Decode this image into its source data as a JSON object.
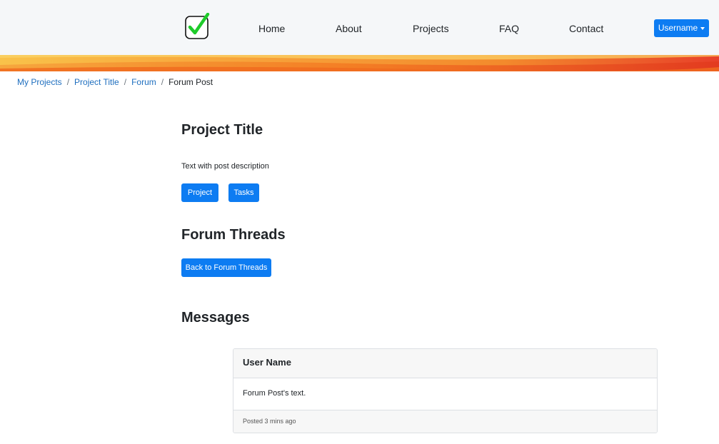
{
  "colors": {
    "primary": "#0d7cf2",
    "link": "#1f6fbf",
    "navbar_bg": "#f5f7f9",
    "wave_orange": "#f4811e",
    "wave_red": "#e8402a",
    "logo_check": "#1ecb2a"
  },
  "header": {
    "logo_icon": "checkbox-check-icon",
    "nav": [
      "Home",
      "About",
      "Projects",
      "FAQ",
      "Contact"
    ],
    "user_button": "Username"
  },
  "breadcrumb": {
    "items": [
      "My Projects",
      "Project Title",
      "Forum"
    ],
    "current": "Forum Post",
    "separator": "/"
  },
  "project": {
    "title": "Project Title",
    "description": "Text with post description",
    "buttons": [
      "Project",
      "Tasks"
    ]
  },
  "forum": {
    "heading": "Forum Threads",
    "back_button": "Back to Forum Threads"
  },
  "messages": {
    "heading": "Messages",
    "card": {
      "user_name": "User Name",
      "text": "Forum Post's text.",
      "posted": "Posted 3 mins ago"
    }
  }
}
